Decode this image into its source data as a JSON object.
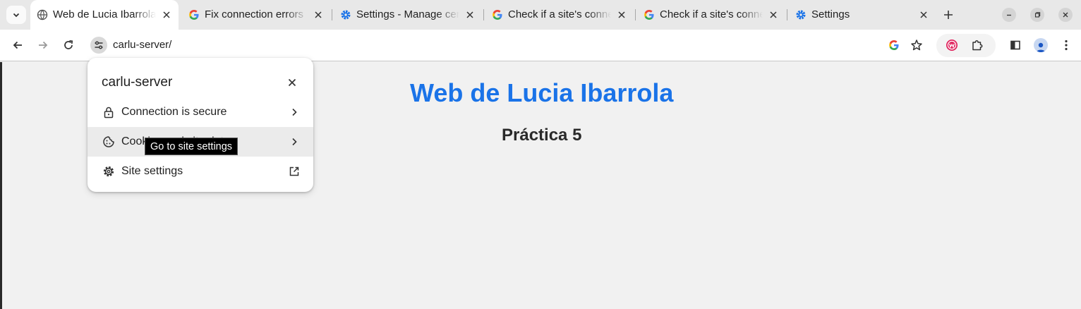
{
  "tabs": [
    {
      "title": "Web de Lucia Ibarrola",
      "favicon": "globe-icon",
      "active": true
    },
    {
      "title": "Fix connection errors",
      "favicon": "google-icon"
    },
    {
      "title": "Settings - Manage certificates",
      "favicon": "settings-gear-icon"
    },
    {
      "title": "Check if a site's connection is secure",
      "favicon": "google-icon"
    },
    {
      "title": "Check if a site's connection is secure",
      "favicon": "google-icon"
    },
    {
      "title": "Settings",
      "favicon": "settings-gear-icon"
    }
  ],
  "toolbar": {
    "url": "carlu-server/"
  },
  "page": {
    "title": "Web de Lucia Ibarrola",
    "subtitle": "Práctica 5"
  },
  "site_info_popup": {
    "host": "carlu-server",
    "rows": [
      {
        "label": "Connection is secure",
        "icon": "lock-icon"
      },
      {
        "label": "Cookies and site data",
        "icon": "cookie-icon"
      },
      {
        "label": "Site settings",
        "icon": "gear-icon"
      }
    ]
  },
  "tooltip": "Go to site settings",
  "colors": {
    "page_title": "#1a73e8",
    "tab_strip": "#e8e8e8",
    "page_background": "#f1f1f1",
    "popup_hover": "#ebebeb"
  }
}
